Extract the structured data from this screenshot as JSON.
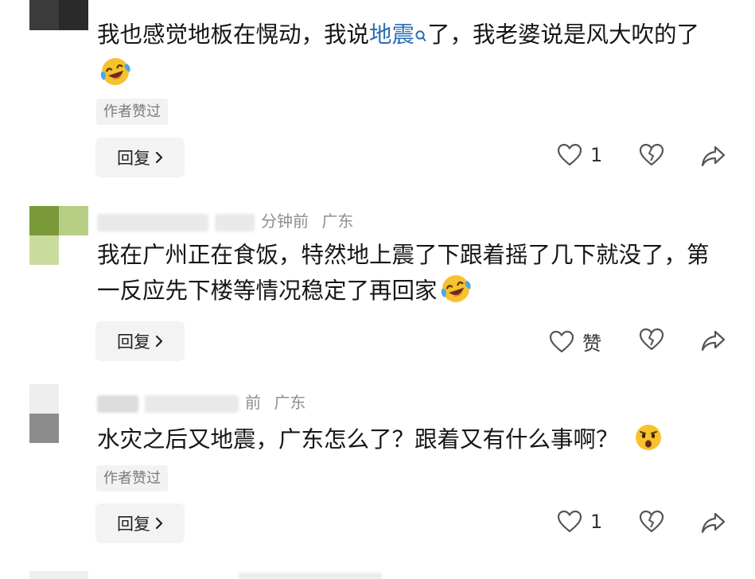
{
  "comments": [
    {
      "text_parts": [
        "我也感觉地板在愰动，我说",
        "地震",
        "了，我老婆说是风大吹的了"
      ],
      "emoji": "laughing-crying-emoji",
      "author_liked": "作者赞过",
      "reply_label": "回复",
      "like_count": "1"
    },
    {
      "meta_time": "分钟前",
      "meta_location": "广东",
      "text": "我在广州正在食饭，特然地上震了下跟着摇了几下就没了，第一反应先下楼等情况稳定了再回家",
      "emoji": "laughing-crying-emoji",
      "reply_label": "回复",
      "like_label": "赞"
    },
    {
      "meta_time": "前",
      "meta_location": "广东",
      "text": "水灾之后又地震，广东怎么了？跟着又有什么事啊？",
      "emoji": "shocked-face-emoji",
      "author_liked": "作者赞过",
      "reply_label": "回复",
      "like_count": "1"
    }
  ],
  "icons": {
    "like": "heart-outline-icon",
    "dislike": "broken-heart-icon",
    "share": "share-arrow-icon",
    "search_hint": "search-icon",
    "reply_chevron": "chevron-right-icon"
  },
  "colors": {
    "link": "#2d6fb3",
    "text": "#161616",
    "muted": "#8f8f8f"
  }
}
